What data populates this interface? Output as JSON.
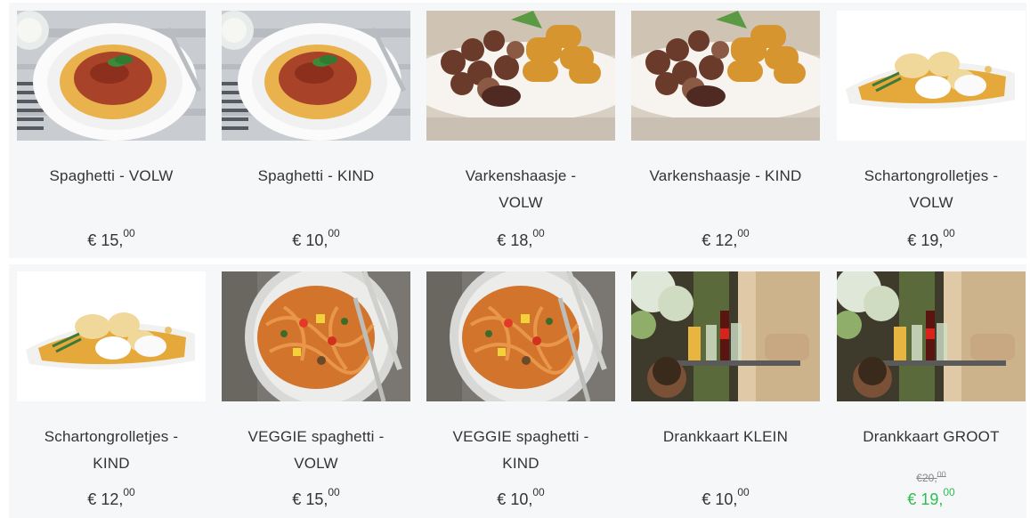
{
  "currency": "€",
  "colors": {
    "row_background": "#f6f7f9",
    "text": "#333333",
    "sale_price": "#2dbe52",
    "old_price": "#888888"
  },
  "products": [
    {
      "name": "Spaghetti - VOLW",
      "price_int": "15,",
      "price_dec": "00",
      "image": "spaghetti-bolognese"
    },
    {
      "name": "Spaghetti - KIND",
      "price_int": "10,",
      "price_dec": "00",
      "image": "spaghetti-bolognese"
    },
    {
      "name": "Varkenshaasje - VOLW",
      "price_int": "18,",
      "price_dec": "00",
      "image": "pork-tenderloin-croquettes"
    },
    {
      "name": "Varkenshaasje - KIND",
      "price_int": "12,",
      "price_dec": "00",
      "image": "pork-tenderloin-croquettes"
    },
    {
      "name": "Schartongrolletjes - VOLW",
      "price_int": "19,",
      "price_dec": "00",
      "image": "fish-rolls"
    },
    {
      "name": "Schartongrolletjes - KIND",
      "price_int": "12,",
      "price_dec": "00",
      "image": "fish-rolls"
    },
    {
      "name": "VEGGIE spaghetti - VOLW",
      "price_int": "15,",
      "price_dec": "00",
      "image": "veggie-pasta"
    },
    {
      "name": "VEGGIE spaghetti - KIND",
      "price_int": "10,",
      "price_dec": "00",
      "image": "veggie-pasta"
    },
    {
      "name": "Drankkaart KLEIN",
      "price_int": "10,",
      "price_dec": "00",
      "image": "drinks-tray"
    },
    {
      "name": "Drankkaart GROOT",
      "price_int": "19,",
      "price_dec": "00",
      "old_price_int": "20,",
      "old_price_dec": "00",
      "image": "drinks-tray"
    }
  ]
}
